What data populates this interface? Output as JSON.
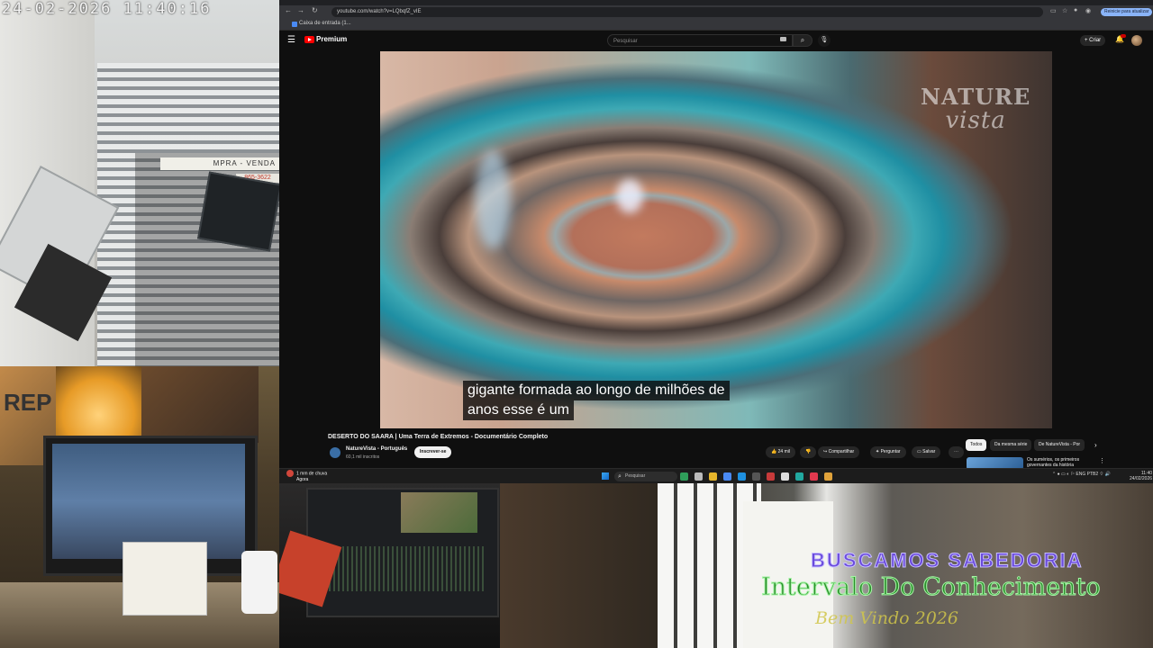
{
  "stream_overlay": {
    "camera_timestamp": "24-02-2026  11:40:16",
    "street_sign": "MPRA - VENDA",
    "street_sign_2": "865-3622",
    "desk_art_text": "REP",
    "overlay_line_1": "BUSCAMOS SABEDORIA",
    "overlay_line_2": "Intervalo Do Conhecimento",
    "overlay_line_3": "Bem Vindo 2026"
  },
  "browser": {
    "url": "youtube.com/watch?v=LQbqfZ_vIE",
    "bookmark": "Caixa de entrada (1...",
    "update_button": "Reinicie para atualizar",
    "nav_back": "←",
    "nav_forward": "→",
    "nav_reload": "↻"
  },
  "youtube": {
    "brand": "Premium",
    "search_placeholder": "Pesquisar",
    "create_label": "+ Criar",
    "video": {
      "watermark_line_1": "NATURE",
      "watermark_line_2": "vista",
      "caption_line_1": "gigante formada ao longo de milhões de",
      "caption_line_2": "anos esse é um"
    },
    "title": "DESERTO DO SAARA | Uma Terra de Extremos - Documentário Completo",
    "channel_name": "NatureVista - Português",
    "subscribers": "60,1 mil inscritos",
    "subscribe_label": "Inscrever-se",
    "likes": "24 mil",
    "share_label": "Compartilhar",
    "ask_label": "Perguntar",
    "save_label": "Salvar",
    "chips": [
      "Todos",
      "Da mesma série",
      "De NatureVista - Por"
    ],
    "rec_title": "Os sumérios, os primeiros governantes da história"
  },
  "taskbar": {
    "weather": "1 mm de chuva",
    "weather_sub": "Agora",
    "search_placeholder": "Pesquisar",
    "tray_lang": "ENG",
    "tray_region": "PTB2",
    "time": "11:40",
    "date": "24/02/2026"
  },
  "colors": {
    "yt_red": "#ff0000",
    "chrome_accent": "#8ab4f8",
    "overlay_purple": "#6b4bdc",
    "overlay_green": "#2b8e2b",
    "overlay_yellow": "#d1c64a"
  }
}
